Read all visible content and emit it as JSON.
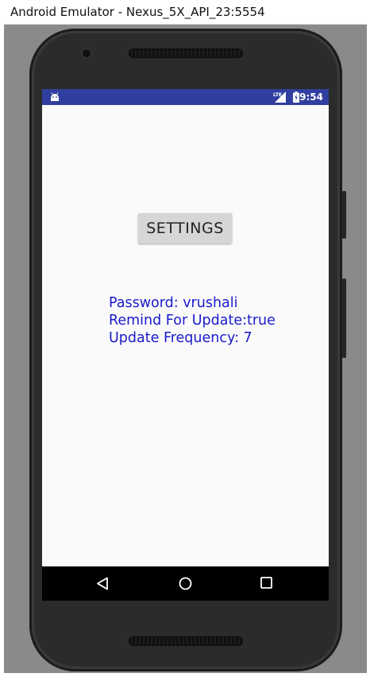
{
  "window": {
    "title": "Android Emulator - Nexus_5X_API_23:5554"
  },
  "statusbar": {
    "time": "9:54",
    "icons": [
      "android-notification-icon",
      "signal-lte-icon",
      "battery-charging-icon"
    ],
    "color": "#303f9f"
  },
  "app": {
    "settings_button_label": "SETTINGS",
    "info_lines": {
      "password": "Password: vrushali",
      "remind": "Remind For Update:true",
      "frequency": "Update Frequency: 7"
    },
    "info_color": "#1a1acc"
  },
  "navbar": {
    "buttons": [
      "back-icon",
      "home-icon",
      "recents-icon"
    ]
  }
}
